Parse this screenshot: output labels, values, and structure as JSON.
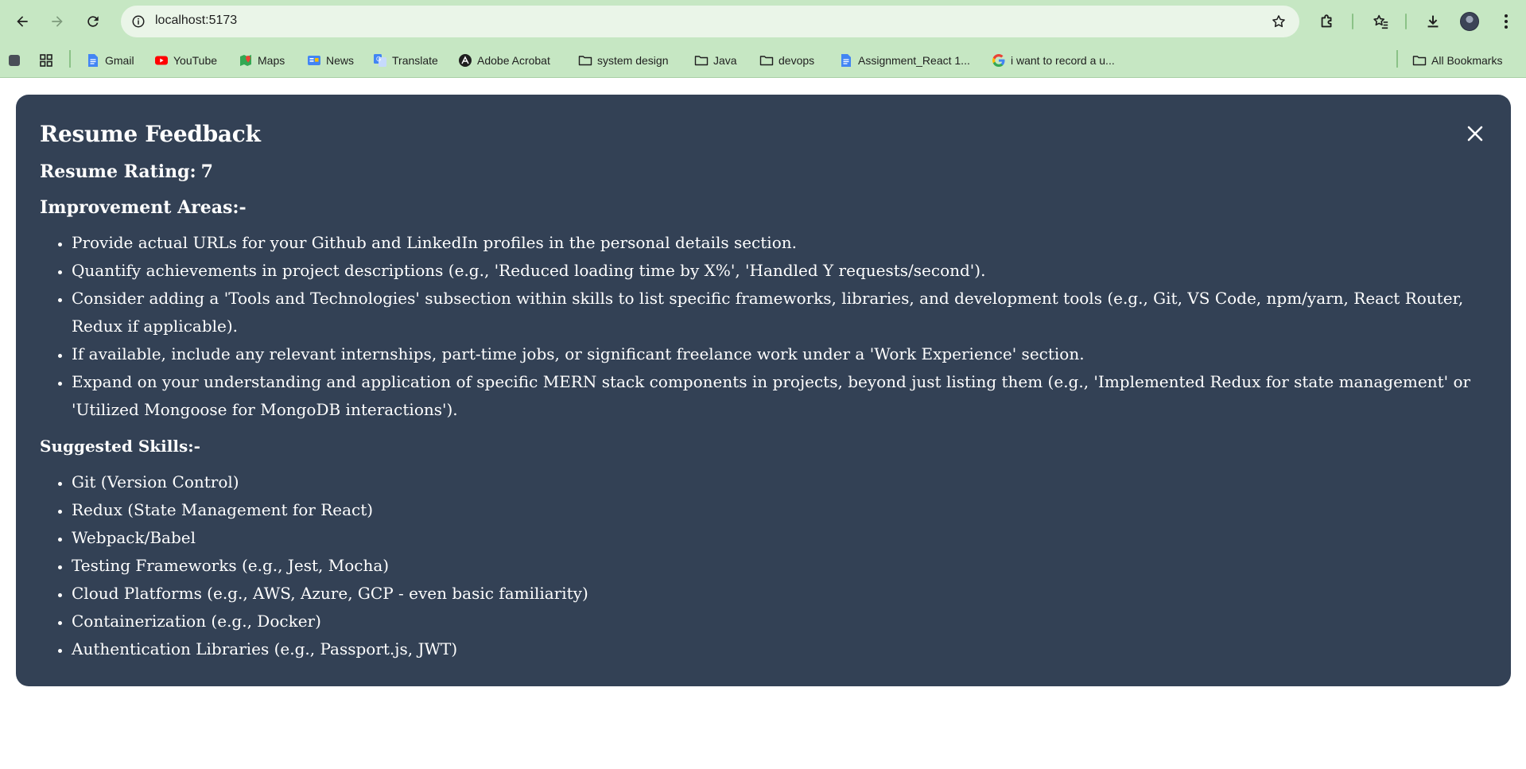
{
  "browser": {
    "url": "localhost:5173",
    "bookmarks": [
      {
        "label": "",
        "icon": "apps-square-icon"
      },
      {
        "label": "",
        "icon": "grid-icon"
      },
      {
        "label": "Gmail",
        "icon": "docs-icon"
      },
      {
        "label": "YouTube",
        "icon": "youtube-icon"
      },
      {
        "label": "Maps",
        "icon": "maps-icon"
      },
      {
        "label": "News",
        "icon": "news-icon"
      },
      {
        "label": "Translate",
        "icon": "translate-icon"
      },
      {
        "label": "Adobe Acrobat",
        "icon": "acrobat-icon"
      },
      {
        "label": "system design",
        "icon": "folder-icon"
      },
      {
        "label": "Java",
        "icon": "folder-icon"
      },
      {
        "label": "devops",
        "icon": "folder-icon"
      },
      {
        "label": "Assignment_React 1...",
        "icon": "docs-icon"
      },
      {
        "label": "i want to record a u...",
        "icon": "google-icon"
      }
    ],
    "all_bookmarks_label": "All Bookmarks"
  },
  "feedback": {
    "title": "Resume Feedback",
    "rating_label": "Resume Rating:",
    "rating_value": "7",
    "improvement_title": "Improvement Areas:-",
    "improvement_items": [
      "Provide actual URLs for your Github and LinkedIn profiles in the personal details section.",
      "Quantify achievements in project descriptions (e.g., 'Reduced loading time by X%', 'Handled Y requests/second').",
      "Consider adding a 'Tools and Technologies' subsection within skills to list specific frameworks, libraries, and development tools (e.g., Git, VS Code, npm/yarn, React Router, Redux if applicable).",
      "If available, include any relevant internships, part-time jobs, or significant freelance work under a 'Work Experience' section.",
      "Expand on your understanding and application of specific MERN stack components in projects, beyond just listing them (e.g., 'Implemented Redux for state management' or 'Utilized Mongoose for MongoDB interactions')."
    ],
    "skills_title": "Suggested Skills:-",
    "skills_items": [
      "Git (Version Control)",
      "Redux (State Management for React)",
      "Webpack/Babel",
      "Testing Frameworks (e.g., Jest, Mocha)",
      "Cloud Platforms (e.g., AWS, Azure, GCP - even basic familiarity)",
      "Containerization (e.g., Docker)",
      "Authentication Libraries (e.g., Passport.js, JWT)"
    ]
  },
  "colors": {
    "chrome_bg": "#c6e7c3",
    "omnibox_bg": "#eaf5e8",
    "card_bg": "#334155",
    "card_text": "#ffffff"
  }
}
